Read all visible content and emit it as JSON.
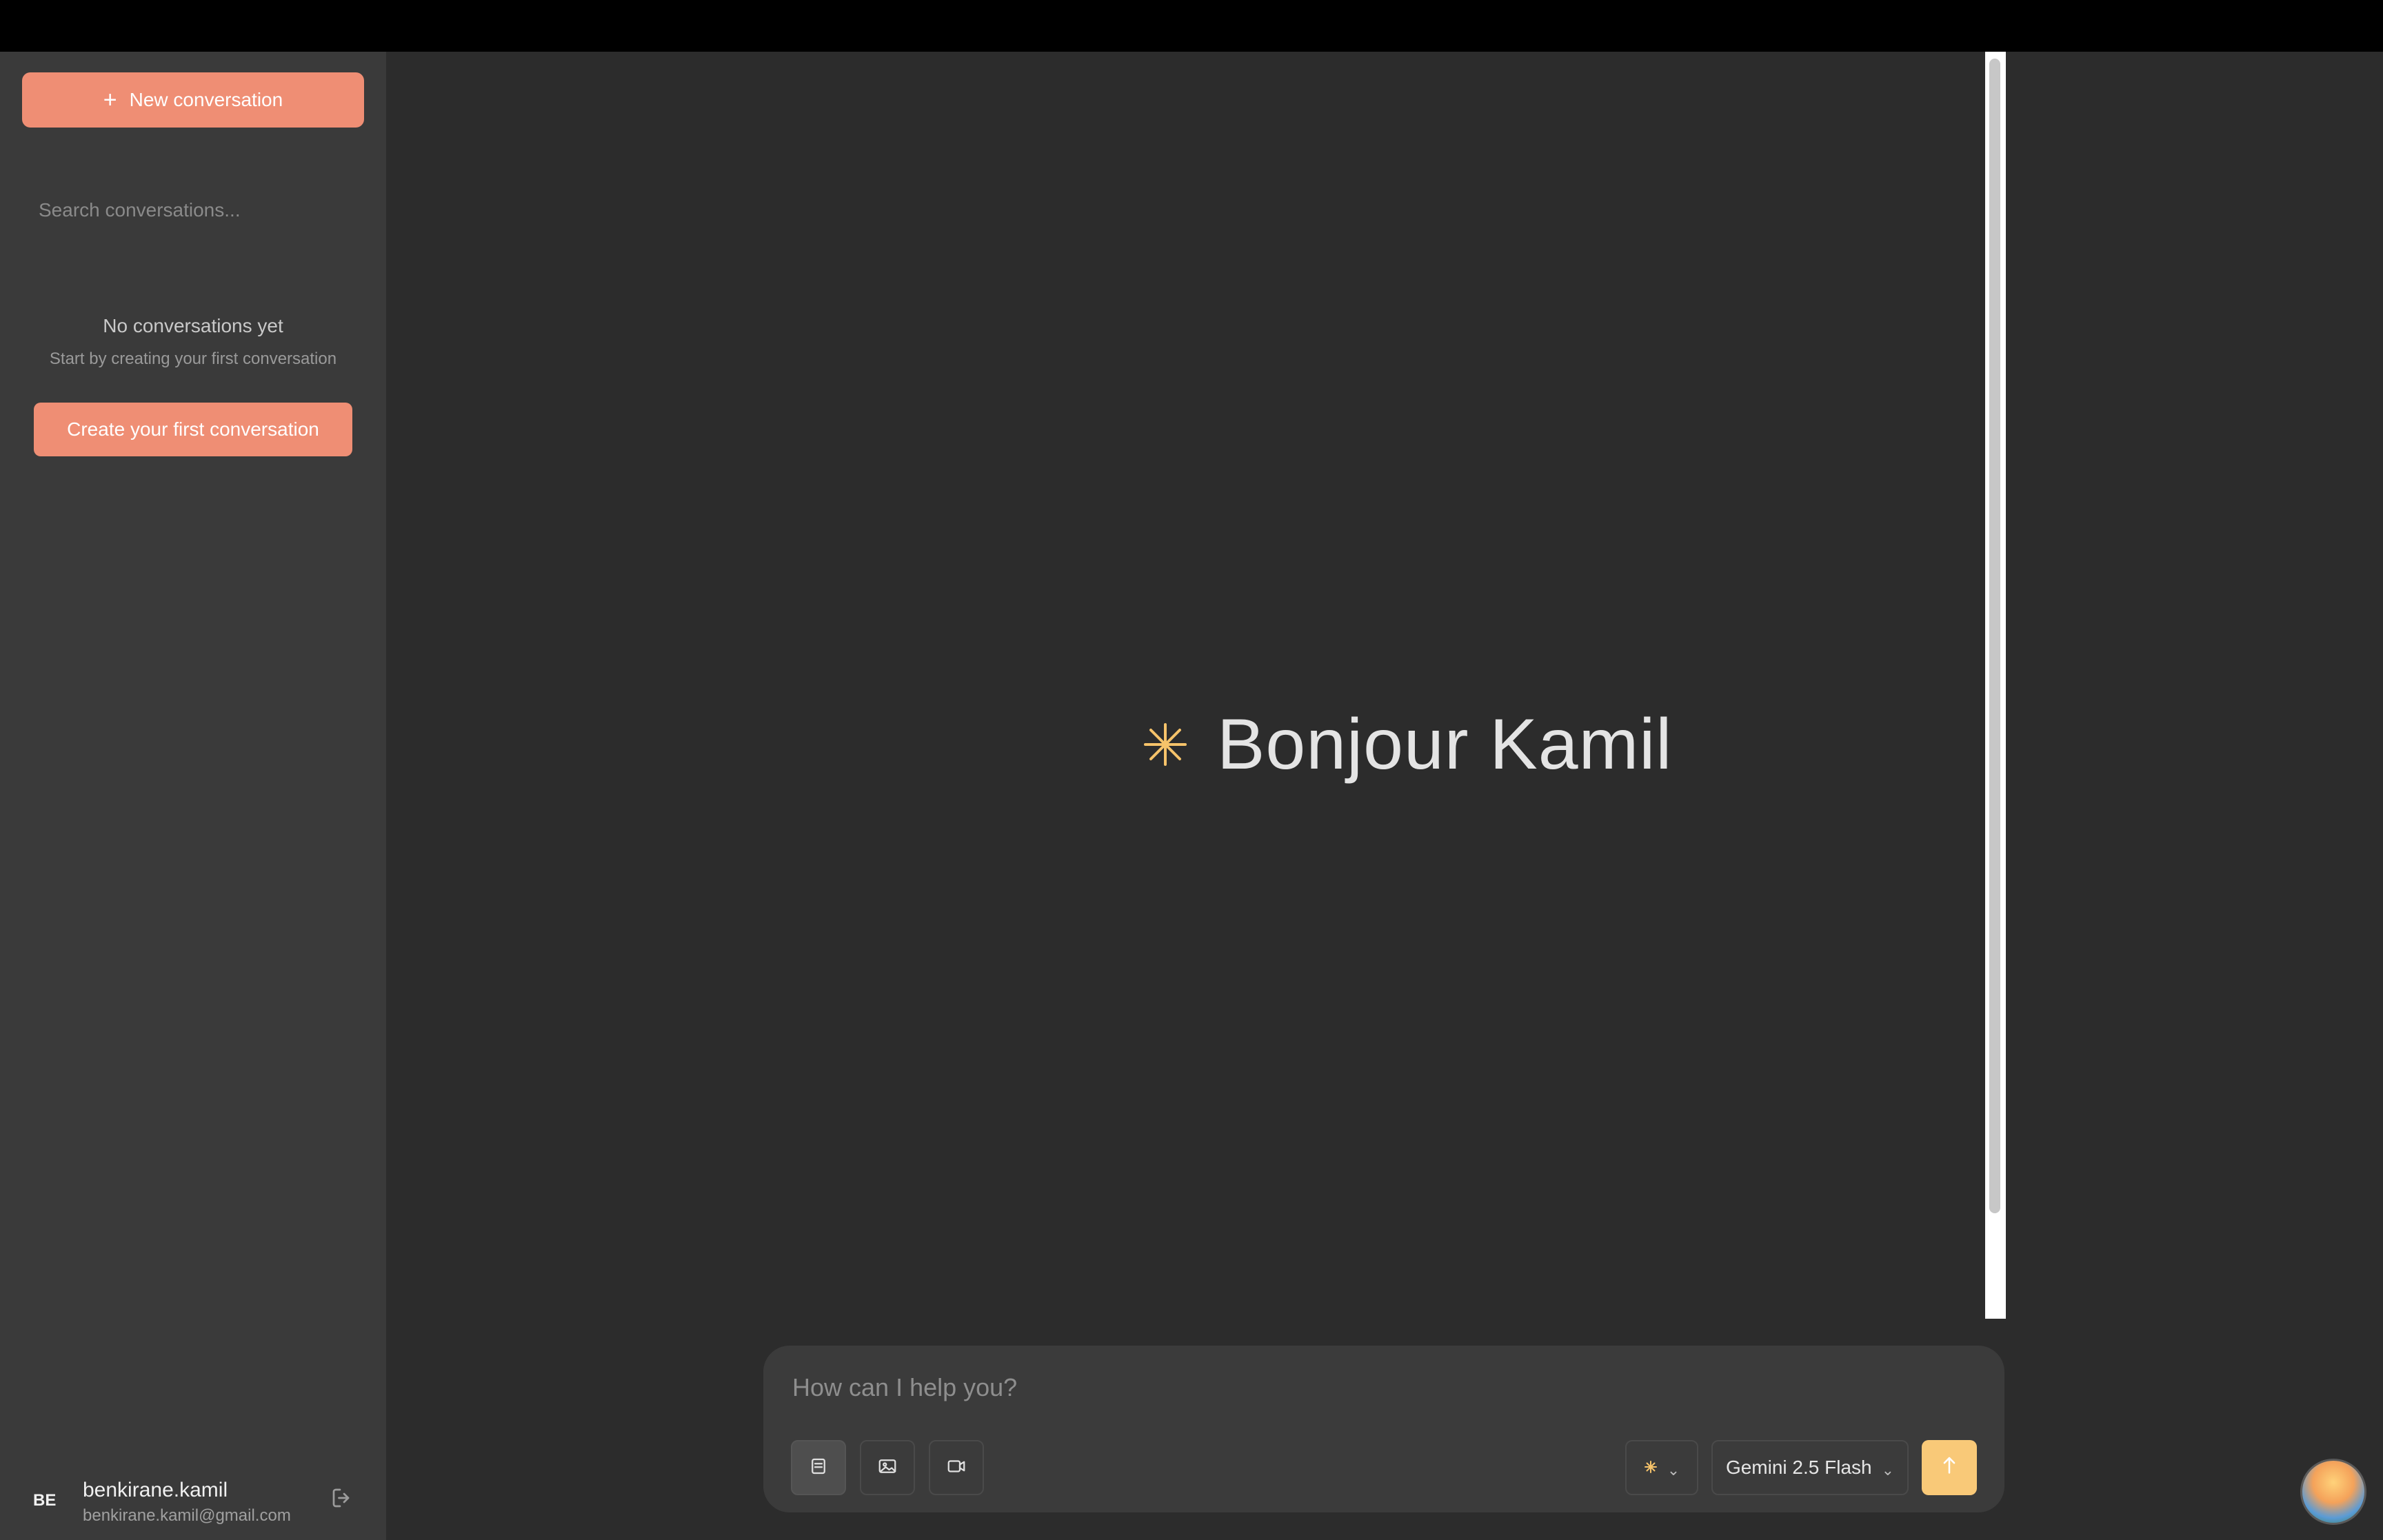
{
  "sidebar": {
    "new_conversation_label": "New conversation",
    "search_placeholder": "Search conversations...",
    "empty_title": "No conversations yet",
    "empty_subtitle": "Start by creating your first conversation",
    "create_first_label": "Create your first conversation",
    "user": {
      "initials": "BE",
      "name": "benkirane.kamil",
      "email": "benkirane.kamil@gmail.com"
    }
  },
  "main": {
    "greeting": "Bonjour Kamil"
  },
  "composer": {
    "placeholder": "How can I help you?",
    "model_label": "Gemini 2.5 Flash",
    "mode_buttons": [
      "text-mode-icon",
      "image-mode-icon",
      "video-mode-icon"
    ],
    "send_icon": "arrow-up-icon"
  },
  "colors": {
    "accent": "#ef8e74",
    "send": "#f9c978",
    "sparkle": "#f6c36a"
  }
}
